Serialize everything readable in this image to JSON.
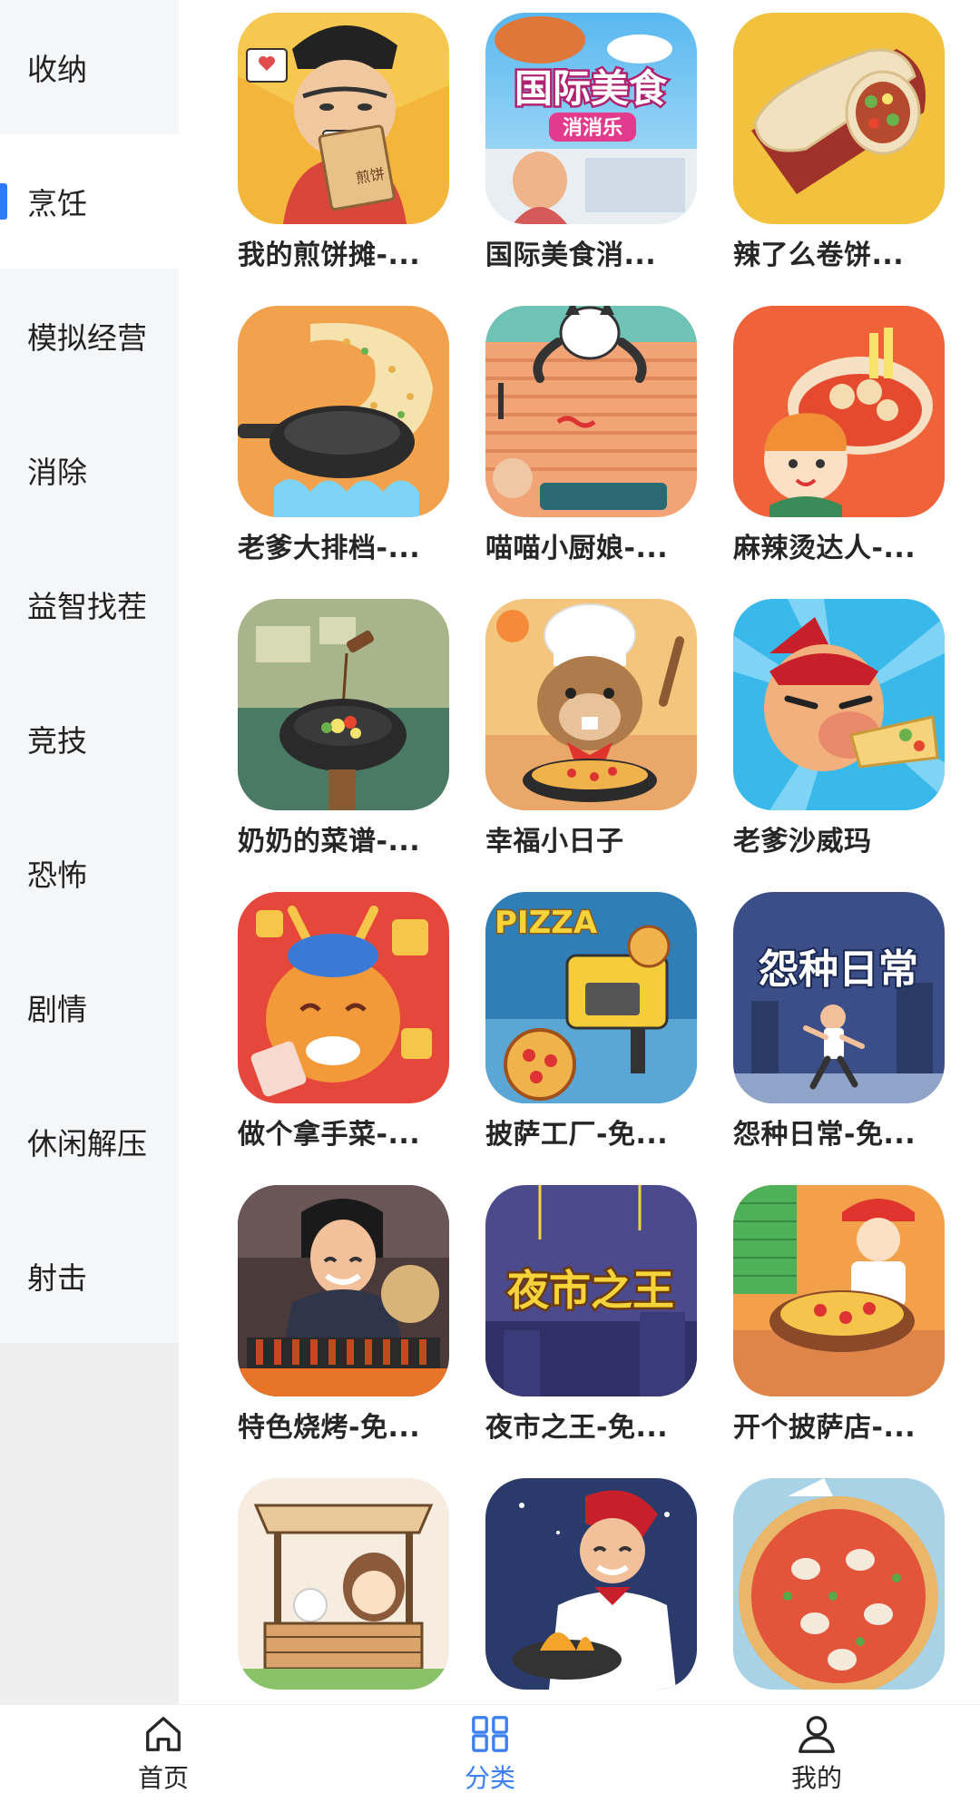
{
  "sidebar": {
    "items": [
      {
        "label": "收纳",
        "active": false
      },
      {
        "label": "烹饪",
        "active": true
      },
      {
        "label": "模拟经营",
        "active": false
      },
      {
        "label": "消除",
        "active": false
      },
      {
        "label": "益智找茬",
        "active": false
      },
      {
        "label": "竞技",
        "active": false
      },
      {
        "label": "恐怖",
        "active": false
      },
      {
        "label": "剧情",
        "active": false
      },
      {
        "label": "休闲解压",
        "active": false
      },
      {
        "label": "射击",
        "active": false
      }
    ],
    "accent_color": "#2f7bf6"
  },
  "games": [
    {
      "title": "我的煎饼摊-...",
      "icon": "pancake-stall-icon",
      "badge_text": "煎饼"
    },
    {
      "title": "国际美食消...",
      "icon": "international-food-icon",
      "badge_text": "国际美食",
      "badge_sub": "消消乐"
    },
    {
      "title": "辣了么卷饼...",
      "icon": "burrito-icon"
    },
    {
      "title": "老爹大排档-...",
      "icon": "wok-fried-rice-icon"
    },
    {
      "title": "喵喵小厨娘-...",
      "icon": "cat-chef-icon"
    },
    {
      "title": "麻辣烫达人-...",
      "icon": "spicy-hotpot-icon"
    },
    {
      "title": "奶奶的菜谱-...",
      "icon": "grandma-wok-icon"
    },
    {
      "title": "幸福小日子",
      "icon": "beaver-pizza-chef-icon"
    },
    {
      "title": "老爹沙威玛",
      "icon": "shawarma-man-icon"
    },
    {
      "title": "做个拿手菜-...",
      "icon": "dragon-dance-icon"
    },
    {
      "title": "披萨工厂-免...",
      "icon": "pizza-factory-icon",
      "badge_text": "PIZZA"
    },
    {
      "title": "怨种日常-免...",
      "icon": "daily-life-runner-icon",
      "badge_text": "怨种日常"
    },
    {
      "title": "特色烧烤-免...",
      "icon": "bbq-grill-icon"
    },
    {
      "title": "夜市之王-免...",
      "icon": "night-market-icon",
      "badge_text": "夜市之王"
    },
    {
      "title": "开个披萨店-...",
      "icon": "pizza-shop-icon"
    },
    {
      "title": "",
      "icon": "food-stall-girl-icon"
    },
    {
      "title": "",
      "icon": "chef-cooking-icon"
    },
    {
      "title": "",
      "icon": "shrimp-pizza-icon"
    }
  ],
  "tabbar": {
    "items": [
      {
        "label": "首页",
        "icon": "home-icon",
        "active": false
      },
      {
        "label": "分类",
        "icon": "category-grid-icon",
        "active": true
      },
      {
        "label": "我的",
        "icon": "profile-icon",
        "active": false
      }
    ],
    "active_color": "#3d80f2"
  }
}
